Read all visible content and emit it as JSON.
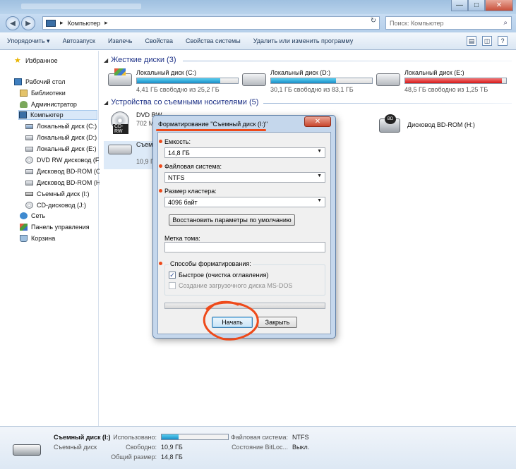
{
  "window": {
    "close_glyph": "✕",
    "maximize_glyph": "□",
    "minimize_glyph": "—"
  },
  "address": {
    "nav_back": "◀",
    "nav_forward": "▶",
    "path": "Компьютер",
    "path_sep": "▸",
    "refresh": "↻",
    "search_placeholder": "Поиск: Компьютер",
    "search_icon": "⌕"
  },
  "toolbar": {
    "items": [
      "Упорядочить ▾",
      "Автозапуск",
      "Извлечь",
      "Свойства",
      "Свойства системы",
      "Удалить или изменить программу"
    ],
    "view_glyph": "▤",
    "preview_glyph": "◫",
    "help_glyph": "?"
  },
  "nav": {
    "favorites": "Избранное",
    "desktop": "Рабочий стол",
    "libraries": "Библиотеки",
    "admin": "Администратор",
    "computer": "Компьютер",
    "drive_c": "Локальный диск (C:)",
    "drive_d": "Локальный диск (D:)",
    "drive_e": "Локальный диск (E:)",
    "dvd": "DVD RW дисковод (F:",
    "bd_g": "Дисковод BD-ROM (С",
    "bd_h": "Дисковод BD-ROM (Н",
    "removable": "Съемный диск (I:)",
    "cd_j": "CD-дисковод (J:)",
    "network": "Сеть",
    "control_panel": "Панель управления",
    "recycle": "Корзина"
  },
  "content": {
    "hdd_header": "Жесткие диски (3)",
    "removable_header": "Устройства со съемными носителями (5)",
    "tri": "◢",
    "drives": [
      {
        "name": "Локальный диск (C:)",
        "free": "4,41 ГБ свободно из 25,2 ГБ",
        "used": 0.825
      },
      {
        "name": "Локальный диск (D:)",
        "free": "30,1 ГБ свободно из 83,1 ГБ",
        "used": 0.64
      },
      {
        "name": "Локальный диск (E:)",
        "free": "48,5 ГБ свободно из 1,25 ТБ",
        "used": 0.96
      }
    ],
    "dvd_name": "DVD RW",
    "dvd_tag": "CD-RW",
    "dvd_size": "702 М",
    "usb_name": "Съем",
    "usb_size": "10,9 Г",
    "bd_name": "Дисковод BD-ROM (H:)",
    "bd_tag": "BD"
  },
  "details": {
    "name": "Съемный диск (I:)",
    "type": "Съемный диск",
    "used_label": "Использовано:",
    "used_fraction": 0.26,
    "free_label": "Свободно:",
    "free_value": "10,9 ГБ",
    "total_label": "Общий размер:",
    "total_value": "14,8 ГБ",
    "fs_label": "Файловая система:",
    "fs_value": "NTFS",
    "bitlocker_label": "Состояние BitLoc...",
    "bitlocker_value": "Выкл."
  },
  "dialog": {
    "title": "Форматирование \"Съемный диск (I:)\"",
    "close": "✕",
    "capacity_label": "Емкость:",
    "capacity_value": "14,8 ГБ",
    "fs_label": "Файловая система:",
    "fs_value": "NTFS",
    "cluster_label": "Размер кластера:",
    "cluster_value": "4096 байт",
    "defaults_button": "Восстановить параметры по умолчанию",
    "volume_label": "Метка тома:",
    "volume_value": "",
    "methods_label": "Способы форматирования:",
    "quick": "Быстрое (очистка оглавления)",
    "quick_check": "✓",
    "msdos": "Создание загрузочного диска MS-DOS",
    "start_button": "Начать",
    "close_button": "Закрыть",
    "arrow": "▼"
  }
}
